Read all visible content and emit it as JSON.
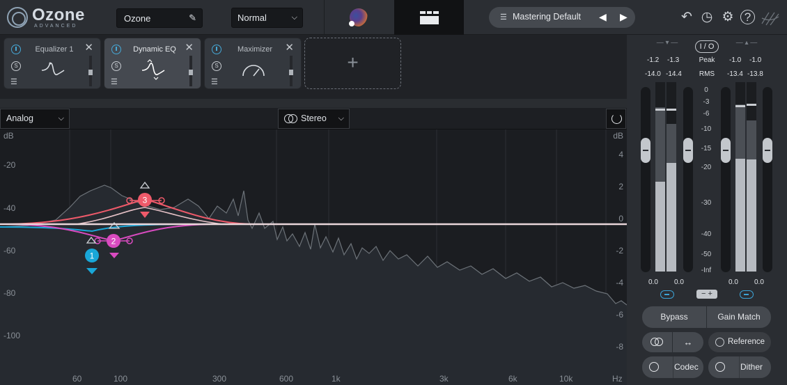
{
  "header": {
    "logo_name": "Ozone",
    "logo_edition": "ADVANCED",
    "preset_name": "Ozone",
    "mode": "Normal",
    "preset_manager": "Mastering Default",
    "icons": [
      "undo-icon",
      "history-icon",
      "settings-icon",
      "help-icon",
      "izotope-logo"
    ]
  },
  "modules": [
    {
      "title": "Equalizer 1",
      "enabled": true,
      "active": false,
      "glyph": "eq-curve"
    },
    {
      "title": "Dynamic EQ",
      "enabled": true,
      "active": true,
      "glyph": "dynamic-eq-curve"
    },
    {
      "title": "Maximizer",
      "enabled": true,
      "active": false,
      "glyph": "gauge"
    }
  ],
  "add_module": "+",
  "eq": {
    "mode": "Analog",
    "channel": "Stereo",
    "left_axis_title": "dB",
    "right_axis_title": "dB",
    "left_ticks": [
      "-20",
      "-40",
      "-60",
      "-80",
      "-100"
    ],
    "right_ticks": [
      "4",
      "2",
      "0",
      "-2",
      "-4",
      "-6",
      "-8"
    ],
    "freq_ticks": [
      "60",
      "100",
      "300",
      "600",
      "1k",
      "3k",
      "6k",
      "10k"
    ],
    "freq_unit": "Hz",
    "nodes": [
      {
        "id": "1",
        "color": "#19a7d8"
      },
      {
        "id": "2",
        "color": "#d94bc0"
      },
      {
        "id": "3",
        "color": "#ef5a6a"
      }
    ]
  },
  "meters": {
    "io_label": "I / O",
    "peak_label": "Peak",
    "rms_label": "RMS",
    "input_peak": [
      "-1.2",
      "-1.3"
    ],
    "input_rms": [
      "-14.0",
      "-14.4"
    ],
    "output_peak": [
      "-1.0",
      "-1.0"
    ],
    "output_rms": [
      "-13.4",
      "-13.8"
    ],
    "scale": [
      "0",
      "-3",
      "-6",
      "-10",
      "-15",
      "-20",
      "-30",
      "-40",
      "-50",
      "-Inf"
    ],
    "input_gain": [
      "0.0",
      "0.0"
    ],
    "output_gain": [
      "0.0",
      "0.0"
    ],
    "buttons": {
      "bypass": "Bypass",
      "gain_match": "Gain Match",
      "reference": "Reference",
      "codec": "Codec",
      "dither": "Dither"
    }
  }
}
